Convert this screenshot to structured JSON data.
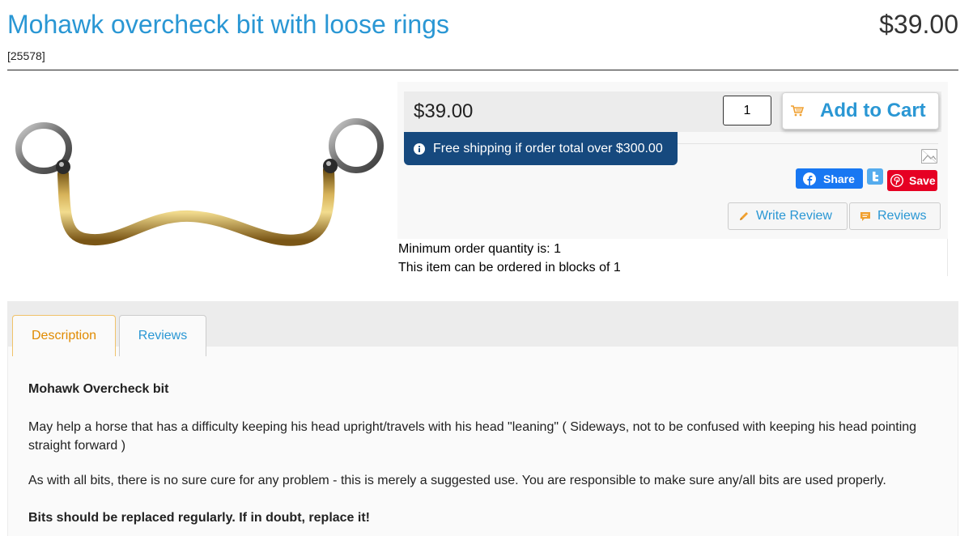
{
  "product": {
    "title": "Mohawk overcheck bit with loose rings",
    "price": "$39.00",
    "sku": "[25578]",
    "image_alt": "Mohawk overcheck bit"
  },
  "buybox": {
    "price": "$39.00",
    "quantity": "1",
    "add_to_cart": "Add to Cart",
    "shipping_notice": "Free shipping if order total over $300.00"
  },
  "social": {
    "facebook_share": "Share",
    "pinterest_save": "Save"
  },
  "review_buttons": {
    "write_review": "Write Review",
    "reviews": "Reviews"
  },
  "order_info": {
    "minimum": "Minimum order quantity is: 1",
    "blocks": "This item can be ordered in blocks of 1"
  },
  "tabs": [
    {
      "label": "Description",
      "active": true
    },
    {
      "label": "Reviews",
      "active": false
    }
  ],
  "description": {
    "heading": "Mohawk Overcheck bit",
    "paragraph1": "May help a horse that has a difficulty keeping his head upright/travels with his head \"leaning\" ( Sideways, not to be confused with keeping his head pointing straight forward )",
    "paragraph2": "As with all bits, there is no sure cure for any problem - this is merely a suggested use. You are responsible to make sure any/all bits are used properly.",
    "warning": "Bits should be replaced regularly. If in doubt, replace it!"
  },
  "colors": {
    "link_blue": "#2a97d4",
    "shipping_banner": "#16497e",
    "active_tab": "#e08a00",
    "facebook": "#1877f2",
    "pinterest": "#e60023"
  },
  "icons": [
    "cart-icon",
    "info-icon",
    "broken-image-icon",
    "facebook-icon",
    "twitter-icon",
    "pinterest-icon",
    "pencil-icon",
    "comment-icon"
  ]
}
